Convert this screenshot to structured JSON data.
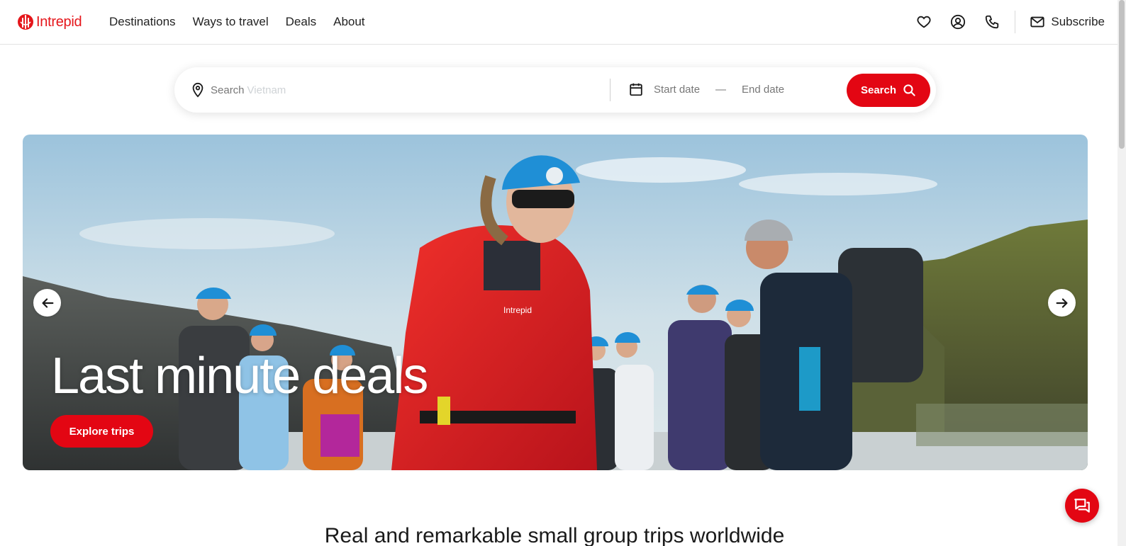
{
  "brand": {
    "name": "Intrepid",
    "accent": "#e30613"
  },
  "nav": {
    "items": [
      {
        "label": "Destinations"
      },
      {
        "label": "Ways to travel"
      },
      {
        "label": "Deals"
      },
      {
        "label": "About"
      }
    ]
  },
  "header_actions": {
    "icons": [
      "heart-icon",
      "account-icon",
      "phone-icon",
      "mail-icon"
    ],
    "subscribe_label": "Subscribe"
  },
  "search": {
    "label": "Search",
    "suggestion": "Vietnam",
    "start_date_placeholder": "Start date",
    "date_separator": "—",
    "end_date_placeholder": "End date",
    "button_label": "Search"
  },
  "hero": {
    "title": "Last minute deals",
    "cta_label": "Explore trips",
    "jacket_logo": "Intrepid"
  },
  "section": {
    "tagline": "Real and remarkable small group trips worldwide"
  }
}
